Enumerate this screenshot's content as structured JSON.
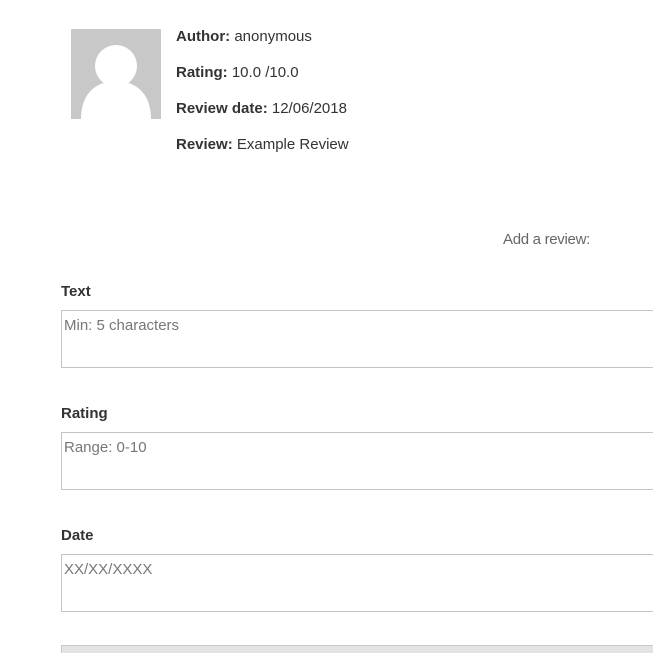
{
  "review": {
    "author_label": "Author:",
    "author_value": "anonymous",
    "rating_label": "Rating:",
    "rating_value": "10.0 /10.0",
    "date_label": "Review date:",
    "date_value": "12/06/2018",
    "text_label": "Review:",
    "text_value": "Example Review",
    "avatar_icon": "default-user-avatar-icon"
  },
  "form": {
    "heading": "Add a review:",
    "text": {
      "label": "Text",
      "placeholder": "Min: 5 characters",
      "value": ""
    },
    "rating": {
      "label": "Rating",
      "placeholder": "Range: 0-10",
      "value": ""
    },
    "date": {
      "label": "Date",
      "placeholder": "XX/XX/XXXX",
      "value": ""
    }
  },
  "colors": {
    "avatar_bg": "#c8c8c8",
    "avatar_fg": "#ffffff",
    "text": "#333333",
    "muted": "#666666",
    "border": "#c4c4c4"
  }
}
